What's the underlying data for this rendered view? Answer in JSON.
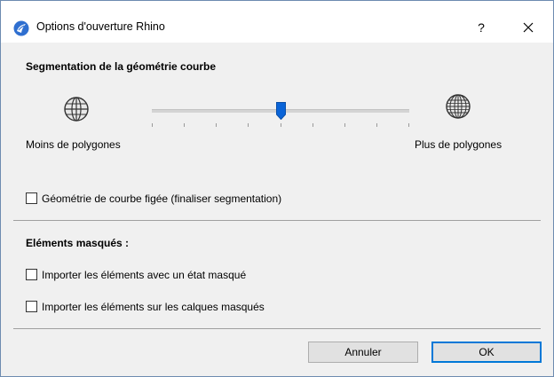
{
  "window": {
    "title": "Options d'ouverture Rhino",
    "help_label": "?",
    "close_icon": "close-icon",
    "app_icon": "rhino-app-icon"
  },
  "segmentation": {
    "heading": "Segmentation de la géométrie courbe",
    "min_label": "Moins de polygones",
    "max_label": "Plus de polygones",
    "slider_value_fraction": 0.5,
    "slider_tick_count": 9,
    "accent_color": "#0a64d8"
  },
  "frozen_geometry": {
    "label": "Géométrie de courbe figée (finaliser segmentation)",
    "checked": false
  },
  "hidden_elements": {
    "heading": "Eléments masqués :",
    "options": [
      {
        "label": "Importer les éléments avec un état masqué",
        "checked": false
      },
      {
        "label": "Importer les éléments sur les calques masqués",
        "checked": false
      }
    ]
  },
  "buttons": {
    "cancel_label": "Annuler",
    "ok_label": "OK"
  }
}
